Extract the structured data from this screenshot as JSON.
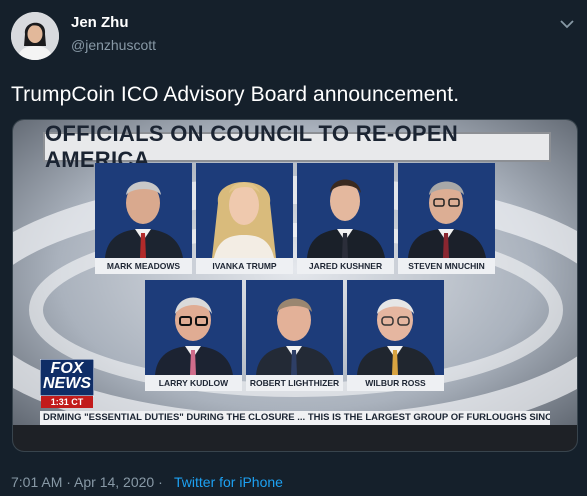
{
  "tweet": {
    "author_name": "Jen Zhu",
    "author_handle": "@jenzhuscott",
    "text": "TrumpCoin ICO Advisory Board announcement.",
    "time": "7:01 AM · Apr 14, 2020 · ",
    "source": "Twitter for iPhone"
  },
  "media": {
    "headline": "OFFICIALS ON COUNCIL TO RE-OPEN AMERICA",
    "officials": [
      {
        "name": "MARK MEADOWS"
      },
      {
        "name": "IVANKA TRUMP"
      },
      {
        "name": "JARED KUSHNER"
      },
      {
        "name": "STEVEN MNUCHIN"
      },
      {
        "name": "LARRY KUDLOW"
      },
      {
        "name": "ROBERT LIGHTHIZER"
      },
      {
        "name": "WILBUR ROSS"
      }
    ],
    "logo_line1": "FOX",
    "logo_line2": "NEWS",
    "logo_time": "1:31 CT",
    "ticker": "DRMING \"ESSENTIAL DUTIES\" DURING THE CLOSURE ...   THIS IS THE LARGEST GROUP OF FURLOUGHS SINC"
  },
  "icons": {
    "menu": "chevron-down-icon",
    "avatar": "avatar"
  },
  "colors": {
    "background": "#15202b",
    "secondary_text": "#8899a6",
    "link": "#1da1f2",
    "fox_red": "#c21b1b"
  }
}
